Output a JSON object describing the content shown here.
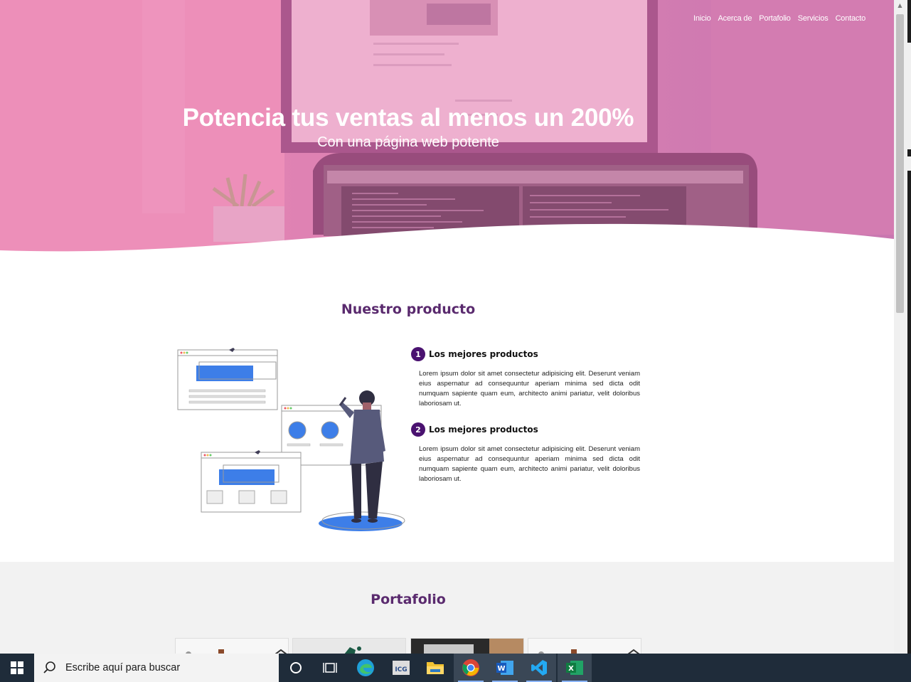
{
  "nav": {
    "items": [
      "Inicio",
      "Acerca de",
      "Portafolio",
      "Servicios",
      "Contacto"
    ]
  },
  "hero": {
    "title": "Potencia tus ventas al menos un 200%",
    "subtitle": "Con una página web potente"
  },
  "product": {
    "title": "Nuestro producto",
    "features": [
      {
        "number": "1",
        "title": "Los mejores productos",
        "text": "Lorem ipsum dolor sit amet consectetur adipisicing elit. Deserunt veniam eius aspernatur ad consequuntur aperiam minima sed dicta odit numquam sapiente quam eum, architecto animi pariatur, velit doloribus laboriosam ut."
      },
      {
        "number": "2",
        "title": "Los mejores productos",
        "text": "Lorem ipsum dolor sit amet consectetur adipisicing elit. Deserunt veniam eius aspernatur ad consequuntur aperiam minima sed dicta odit numquam sapiente quam eum, architecto animi pariatur, velit doloribus laboriosam ut."
      }
    ]
  },
  "portfolio": {
    "title": "Portafolio"
  },
  "taskbar": {
    "search_placeholder": "Escribe aquí para buscar",
    "apps": [
      "cortana-icon",
      "task-view-icon",
      "edge-icon",
      "icg-app-icon",
      "file-explorer-icon",
      "chrome-icon",
      "word-icon",
      "vscode-icon",
      "excel-icon"
    ]
  },
  "colors": {
    "accent": "#5a2a6e",
    "number_badge": "#4a1270",
    "hero_pink": "#e68ab6",
    "illustration_blue": "#3d7ee8"
  }
}
